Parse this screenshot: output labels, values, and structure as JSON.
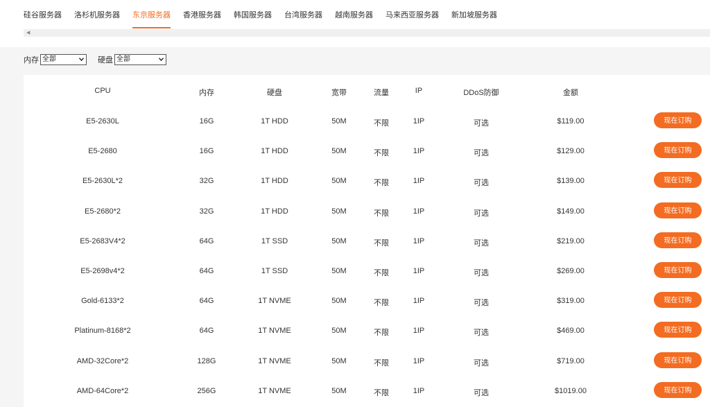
{
  "tabs": [
    {
      "label": "硅谷服务器",
      "active": false
    },
    {
      "label": "洛杉机服务器",
      "active": false
    },
    {
      "label": "东京服务器",
      "active": true
    },
    {
      "label": "香港服务器",
      "active": false
    },
    {
      "label": "韩国服务器",
      "active": false
    },
    {
      "label": "台湾服务器",
      "active": false
    },
    {
      "label": "越南服务器",
      "active": false
    },
    {
      "label": "马来西亚服务器",
      "active": false
    },
    {
      "label": "新加坡服务器",
      "active": false
    }
  ],
  "colors": {
    "accent": "#f36c21"
  },
  "filters": {
    "memory": {
      "label": "内存",
      "value": "全部"
    },
    "disk": {
      "label": "硬盘",
      "value": "全部"
    }
  },
  "table": {
    "headers": [
      "CPU",
      "内存",
      "硬盘",
      "宽带",
      "流量",
      "IP",
      "DDoS防御",
      "金额"
    ],
    "rows": [
      {
        "cpu": "E5-2630L",
        "mem": "16G",
        "disk": "1T HDD",
        "bw": "50M",
        "traffic": "不限",
        "ip": "1IP",
        "ddos": "可选",
        "price": "$119.00",
        "action": "现在订购"
      },
      {
        "cpu": "E5-2680",
        "mem": "16G",
        "disk": "1T HDD",
        "bw": "50M",
        "traffic": "不限",
        "ip": "1IP",
        "ddos": "可选",
        "price": "$129.00",
        "action": "现在订购"
      },
      {
        "cpu": "E5-2630L*2",
        "mem": "32G",
        "disk": "1T HDD",
        "bw": "50M",
        "traffic": "不限",
        "ip": "1IP",
        "ddos": "可选",
        "price": "$139.00",
        "action": "现在订购"
      },
      {
        "cpu": "E5-2680*2",
        "mem": "32G",
        "disk": "1T HDD",
        "bw": "50M",
        "traffic": "不限",
        "ip": "1IP",
        "ddos": "可选",
        "price": "$149.00",
        "action": "现在订购"
      },
      {
        "cpu": "E5-2683V4*2",
        "mem": "64G",
        "disk": "1T SSD",
        "bw": "50M",
        "traffic": "不限",
        "ip": "1IP",
        "ddos": "可选",
        "price": "$219.00",
        "action": "现在订购"
      },
      {
        "cpu": "E5-2698v4*2",
        "mem": "64G",
        "disk": "1T SSD",
        "bw": "50M",
        "traffic": "不限",
        "ip": "1IP",
        "ddos": "可选",
        "price": "$269.00",
        "action": "现在订购"
      },
      {
        "cpu": "Gold-6133*2",
        "mem": "64G",
        "disk": "1T NVME",
        "bw": "50M",
        "traffic": "不限",
        "ip": "1IP",
        "ddos": "可选",
        "price": "$319.00",
        "action": "现在订购"
      },
      {
        "cpu": "Platinum-8168*2",
        "mem": "64G",
        "disk": "1T NVME",
        "bw": "50M",
        "traffic": "不限",
        "ip": "1IP",
        "ddos": "可选",
        "price": "$469.00",
        "action": "现在订购"
      },
      {
        "cpu": "AMD-32Core*2",
        "mem": "128G",
        "disk": "1T NVME",
        "bw": "50M",
        "traffic": "不限",
        "ip": "1IP",
        "ddos": "可选",
        "price": "$719.00",
        "action": "现在订购"
      },
      {
        "cpu": "AMD-64Core*2",
        "mem": "256G",
        "disk": "1T NVME",
        "bw": "50M",
        "traffic": "不限",
        "ip": "1IP",
        "ddos": "可选",
        "price": "$1019.00",
        "action": "现在订购"
      }
    ]
  }
}
